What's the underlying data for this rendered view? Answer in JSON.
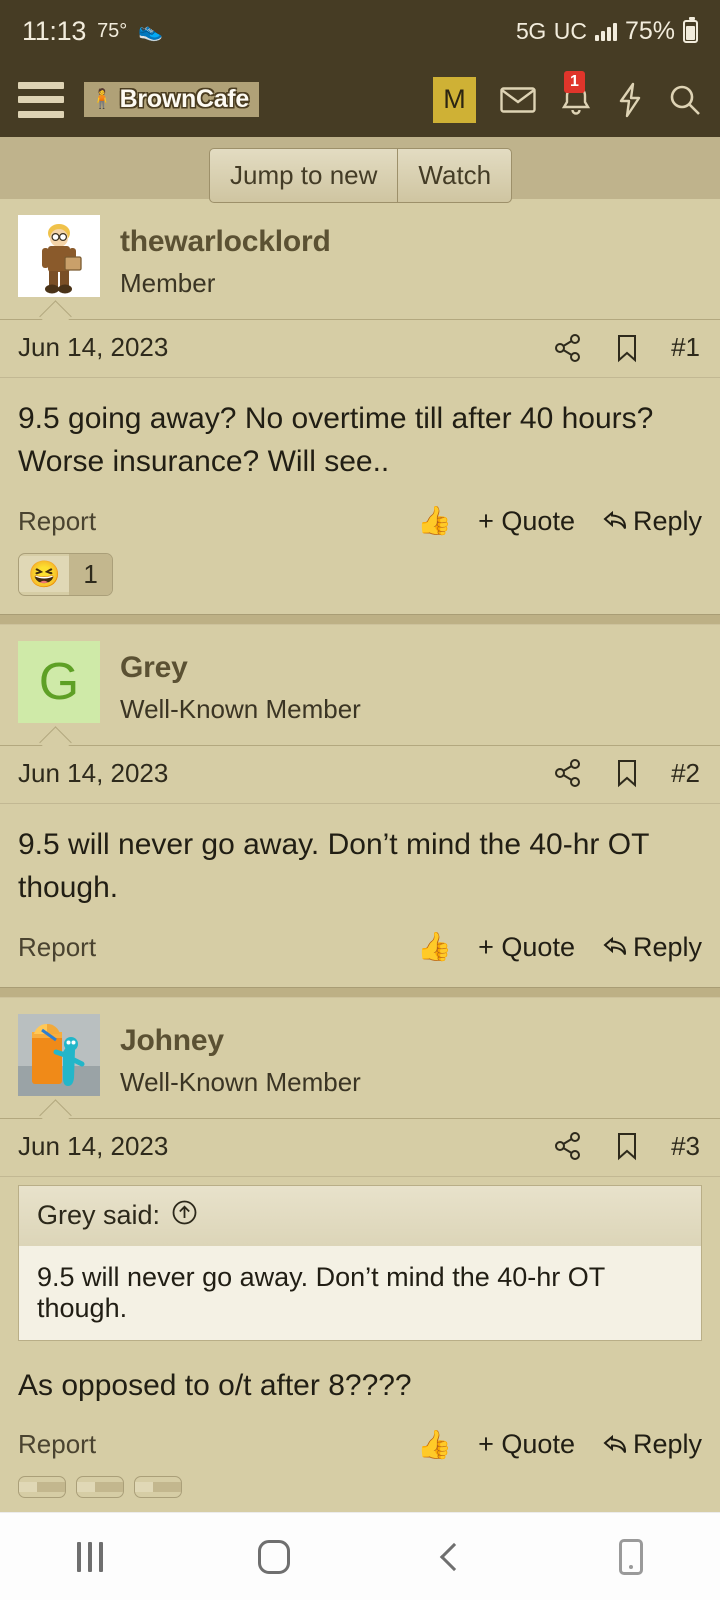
{
  "status_bar": {
    "time": "11:13",
    "temperature": "75°",
    "step_icon": "👟",
    "network": "5G",
    "network_suffix": "UC",
    "battery_percent": "75%"
  },
  "app_bar": {
    "menu_icon": "hamburger-menu-icon",
    "logo_text": "BrownCafe",
    "logo_figure": "🧍",
    "profile_initial": "M",
    "inbox_icon": "envelope-icon",
    "alerts_icon": "bell-icon",
    "alerts_count": "1",
    "bolt_icon": "lightning-bolt-icon",
    "search_icon": "search-icon"
  },
  "top_actions": {
    "jump_to_new": "Jump to new",
    "watch": "Watch"
  },
  "posts": [
    {
      "username": "thewarlocklord",
      "user_title": "Member",
      "avatar_type": "photo",
      "avatar_alt": "ups-driver-cartoon-avatar",
      "date": "Jun 14, 2023",
      "post_number": "#1",
      "body": "9.5 going away? No overtime till after 40 hours? Worse insurance? Will see..",
      "report_label": "Report",
      "quote_label": "+ Quote",
      "reply_label": "Reply",
      "thumb_icon": "👍",
      "reactions": [
        {
          "emoji": "😆",
          "count": "1"
        }
      ]
    },
    {
      "username": "Grey",
      "user_title": "Well-Known Member",
      "avatar_type": "letter",
      "avatar_letter": "G",
      "date": "Jun 14, 2023",
      "post_number": "#2",
      "body": "9.5 will never go away. Don’t mind the 40-hr OT though.",
      "report_label": "Report",
      "quote_label": "+ Quote",
      "reply_label": "Reply",
      "thumb_icon": "👍",
      "reactions": []
    },
    {
      "username": "Johney",
      "user_title": "Well-Known Member",
      "avatar_type": "photo",
      "avatar_alt": "orange-drink-gumby-avatar",
      "date": "Jun 14, 2023",
      "post_number": "#3",
      "quote": {
        "attribution": "Grey said:",
        "link_icon": "up-arrow-circle-icon",
        "text": "9.5 will never go away. Don’t mind the 40-hr OT though."
      },
      "body": "As opposed to o/t after 8????",
      "report_label": "Report",
      "quote_label": "+ Quote",
      "reply_label": "Reply",
      "thumb_icon": "👍",
      "reactions": [
        {
          "emoji": "",
          "count": ""
        },
        {
          "emoji": "",
          "count": ""
        },
        {
          "emoji": "",
          "count": ""
        }
      ]
    }
  ],
  "nav_bar": {
    "recents": "recents-icon",
    "home": "home-icon",
    "back": "back-icon",
    "screenshot": "screenshot-icon"
  },
  "colors": {
    "header_bg": "#463c24",
    "page_bg": "#d6cda5",
    "accent_yellow": "#cfb135",
    "badge_red": "#e0352b",
    "avatar_green_bg": "#cfeaa8",
    "avatar_green_fg": "#5ea025"
  }
}
